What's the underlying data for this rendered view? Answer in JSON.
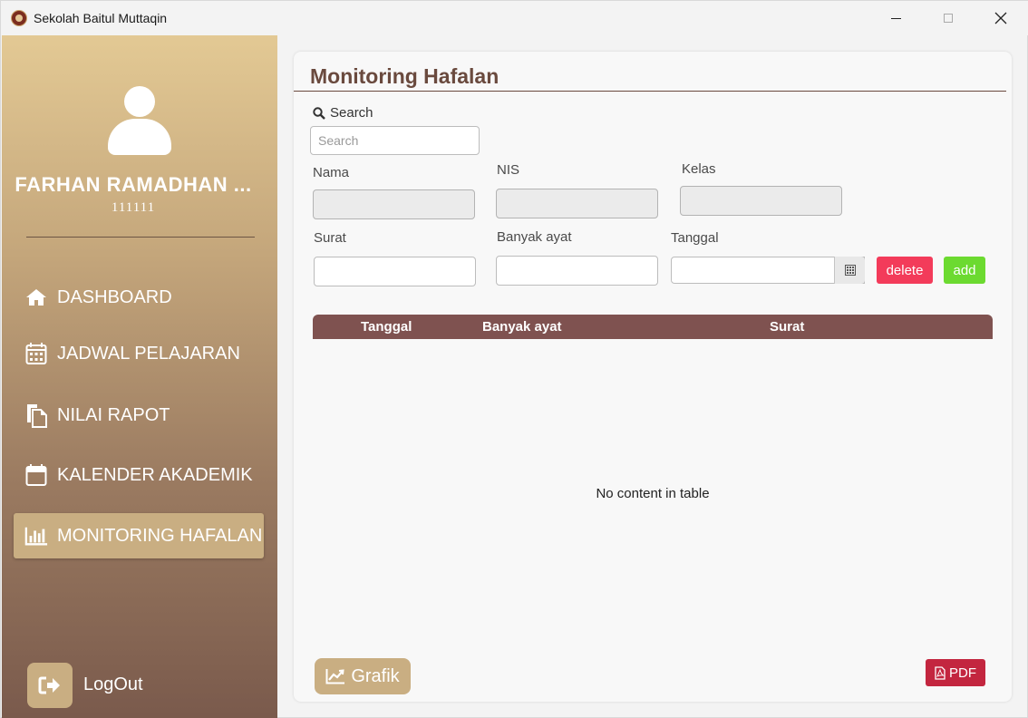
{
  "window": {
    "title": "Sekolah Baitul Muttaqin",
    "icon": "school-logo-icon"
  },
  "sidebar": {
    "user_name": "FARHAN RAMADHAN ...",
    "user_id": "111111",
    "items": [
      {
        "label": "DASHBOARD",
        "icon": "home-icon"
      },
      {
        "label": "JADWAL PELAJARAN",
        "icon": "calendar-grid-icon"
      },
      {
        "label": "NILAI RAPOT",
        "icon": "documents-icon"
      },
      {
        "label": "KALENDER AKADEMIK",
        "icon": "calendar-icon"
      },
      {
        "label": "MONITORING HAFALAN",
        "icon": "bar-chart-icon",
        "active": true
      }
    ],
    "logout_label": "LogOut"
  },
  "main": {
    "title": "Monitoring Hafalan",
    "search": {
      "label": "Search",
      "placeholder": "Search"
    },
    "fields": {
      "nama": "Nama",
      "nis": "NIS",
      "kelas": "Kelas",
      "surat": "Surat",
      "banyak_ayat": "Banyak ayat",
      "tanggal": "Tanggal"
    },
    "buttons": {
      "delete": "delete",
      "add": "add",
      "grafik": "Grafik",
      "pdf": "PDF"
    },
    "table": {
      "columns": [
        "Tanggal",
        "Banyak ayat",
        "Surat"
      ],
      "empty_text": "No content in table"
    }
  },
  "colors": {
    "accent": "#c9ae82",
    "table_header": "#7f5250",
    "title": "#6a4a3e",
    "delete": "#f33b5a",
    "add": "#6cda30",
    "pdf": "#c3263f"
  }
}
